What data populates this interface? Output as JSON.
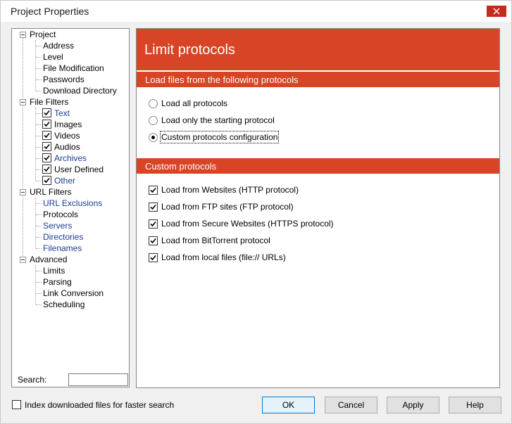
{
  "window": {
    "title": "Project Properties"
  },
  "tree": {
    "project": {
      "label": "Project",
      "children": [
        "Address",
        "Level",
        "File Modification",
        "Passwords",
        "Download Directory"
      ]
    },
    "file_filters": {
      "label": "File Filters",
      "children": [
        "Text",
        "Images",
        "Videos",
        "Audios",
        "Archives",
        "User Defined",
        "Other"
      ]
    },
    "url_filters": {
      "label": "URL Filters",
      "children": [
        "URL Exclusions",
        "Protocols",
        "Servers",
        "Directories",
        "Filenames"
      ]
    },
    "advanced": {
      "label": "Advanced",
      "children": [
        "Limits",
        "Parsing",
        "Link Conversion",
        "Scheduling"
      ]
    }
  },
  "search": {
    "label": "Search:",
    "value": ""
  },
  "panel": {
    "title": "Limit protocols",
    "section1": "Load files from the following protocols",
    "radios": [
      {
        "label": "Load all protocols",
        "selected": false
      },
      {
        "label": "Load only the starting protocol",
        "selected": false
      },
      {
        "label": "Custom protocols configuration",
        "selected": true
      }
    ],
    "section2": "Custom protocols",
    "checks": [
      {
        "label": "Load from Websites (HTTP protocol)",
        "checked": true
      },
      {
        "label": "Load from FTP sites (FTP protocol)",
        "checked": true
      },
      {
        "label": "Load from Secure Websites (HTTPS protocol)",
        "checked": true
      },
      {
        "label": "Load from BitTorrent protocol",
        "checked": true
      },
      {
        "label": "Load from local files (file:// URLs)",
        "checked": true
      }
    ]
  },
  "footer": {
    "index_label": "Index downloaded files for faster search",
    "ok": "OK",
    "cancel": "Cancel",
    "apply": "Apply",
    "help": "Help"
  },
  "colors": {
    "accent": "#d74426",
    "close": "#c42b1c",
    "link": "#1a3c8f"
  }
}
